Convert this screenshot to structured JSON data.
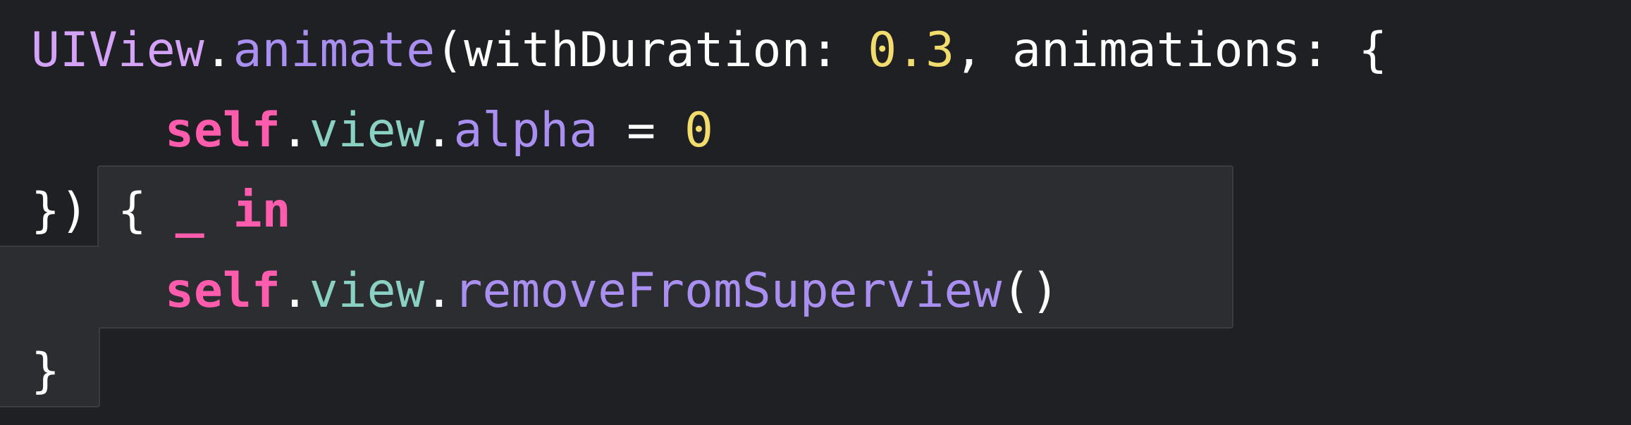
{
  "code": {
    "line1": {
      "type_name": "UIView",
      "dot1": ".",
      "method": "animate",
      "open_paren": "(",
      "arg1_label": "withDuration: ",
      "arg1_value": "0.3",
      "comma": ", ",
      "arg2_label": "animations: ",
      "open_brace": "{"
    },
    "line2": {
      "keyword_self": "self",
      "dot1": ".",
      "prop_view": "view",
      "dot2": ".",
      "prop_alpha": "alpha",
      "assign": " = ",
      "value": "0"
    },
    "line3": {
      "close": "})",
      "space": " ",
      "open_brace": "{ ",
      "underscore": "_",
      "space2": " ",
      "keyword_in": "in"
    },
    "line4": {
      "keyword_self": "self",
      "dot1": ".",
      "prop_view": "view",
      "dot2": ".",
      "method": "removeFromSuperview",
      "parens": "()"
    },
    "line5": {
      "close_brace": "}"
    }
  },
  "colors": {
    "background": "#1f2023",
    "highlight": "#2b2d31",
    "type": "#d4a3f7",
    "method": "#a98ff0",
    "number": "#f2dc6e",
    "keyword": "#ff5cae",
    "property": "#8ad1c4",
    "plain": "#ffffff"
  }
}
